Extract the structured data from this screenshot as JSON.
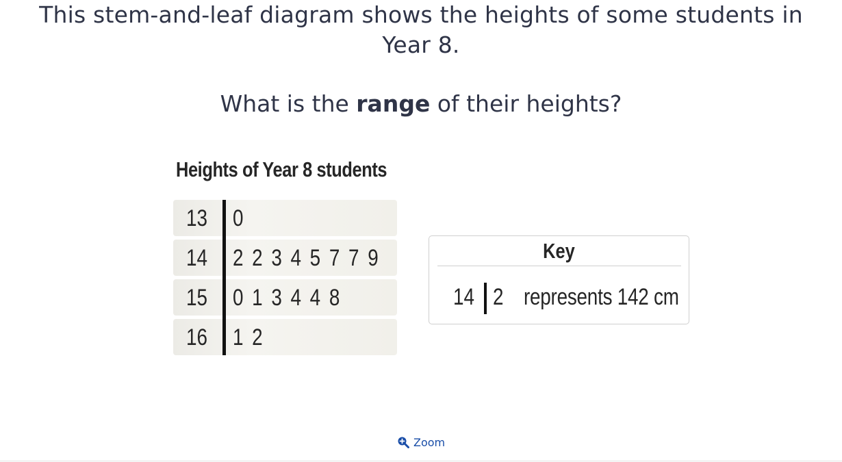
{
  "question": {
    "text": "This stem-and-leaf diagram shows the heights of some students in Year 8.",
    "prompt_before": "What is the ",
    "prompt_bold": "range",
    "prompt_after": " of their heights?"
  },
  "diagram": {
    "title": "Heights of  Year 8 students",
    "rows": [
      {
        "stem": "13",
        "leaves": "0"
      },
      {
        "stem": "14",
        "leaves": "2 2 3 4 5 7 7 9"
      },
      {
        "stem": "15",
        "leaves": "0 1 3 4 4 8"
      },
      {
        "stem": "16",
        "leaves": "1 2"
      }
    ]
  },
  "key": {
    "title": "Key",
    "stem": "14",
    "leaf": "2",
    "description": "represents 142 cm"
  },
  "zoom": {
    "label": "Zoom",
    "icon": "zoom-in-icon",
    "color": "#1a4ea8"
  }
}
